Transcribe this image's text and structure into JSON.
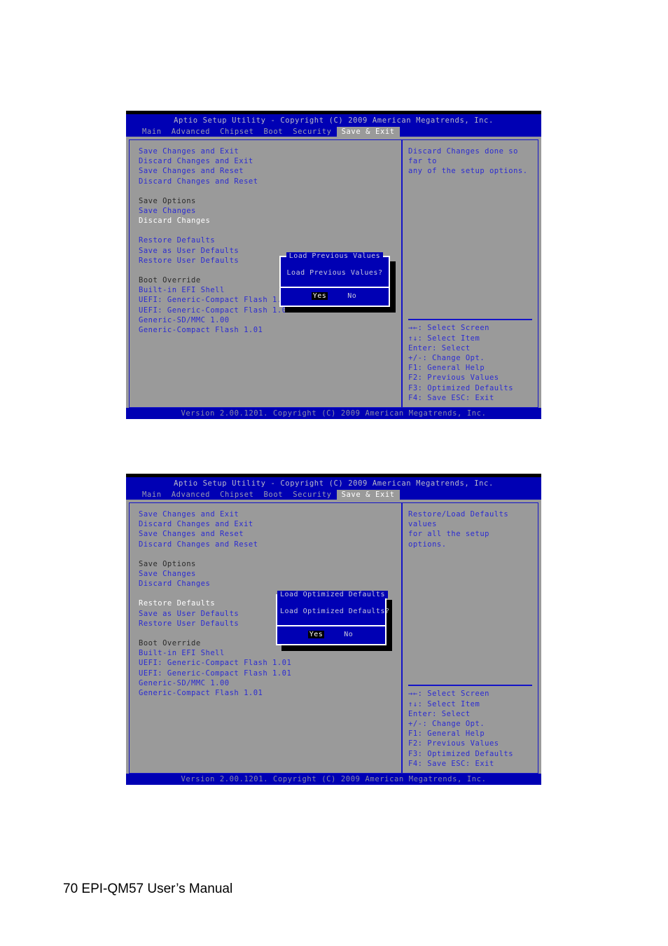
{
  "page": {
    "footer_text": "70 EPI-QM57 User’s Manual"
  },
  "colors": {
    "bios_blue": "#0000b4",
    "bios_gray": "#9a9a9a",
    "item_blue": "#2b2bd2",
    "selected_white": "#ffffff",
    "header_dark": "#2a2a2a",
    "focus_black": "#000000"
  },
  "common": {
    "title": "Aptio Setup Utility - Copyright (C) 2009 American Megatrends, Inc.",
    "version": "Version 2.00.1201. Copyright (C) 2009 American Megatrends, Inc.",
    "tabs": [
      {
        "label": "Main",
        "active": false
      },
      {
        "label": "Advanced",
        "active": false
      },
      {
        "label": "Chipset",
        "active": false
      },
      {
        "label": "Boot",
        "active": false
      },
      {
        "label": "Security",
        "active": false
      },
      {
        "label": "Save & Exit",
        "active": true
      }
    ],
    "keys": [
      "→←: Select Screen",
      "↑↓: Select Item",
      "Enter: Select",
      "+/-: Change Opt.",
      "F1: General Help",
      "F2: Previous Values",
      "F3: Optimized Defaults",
      "F4: Save  ESC: Exit"
    ],
    "menu_items": [
      {
        "label": "Save Changes and Exit",
        "style": "item"
      },
      {
        "label": "Discard Changes and Exit",
        "style": "item"
      },
      {
        "label": "Save Changes and Reset",
        "style": "item"
      },
      {
        "label": "Discard Changes and Reset",
        "style": "item"
      },
      {
        "label": "",
        "style": "spacer"
      },
      {
        "label": "Save Options",
        "style": "header"
      },
      {
        "label": "Save Changes",
        "style": "item"
      },
      {
        "label": "Discard Changes",
        "style": "item"
      },
      {
        "label": "",
        "style": "spacer"
      },
      {
        "label": "Restore Defaults",
        "style": "item"
      },
      {
        "label": "Save as User Defaults",
        "style": "item"
      },
      {
        "label": "Restore User Defaults",
        "style": "item"
      },
      {
        "label": "",
        "style": "spacer"
      },
      {
        "label": "Boot Override",
        "style": "header"
      },
      {
        "label": "Built-in EFI Shell",
        "style": "item"
      },
      {
        "label": "UEFI: Generic-Compact Flash 1.01",
        "style": "item"
      },
      {
        "label": "UEFI: Generic-Compact Flash 1.01",
        "style": "item"
      },
      {
        "label": "Generic-SD/MMC 1.00",
        "style": "item"
      },
      {
        "label": "Generic-Compact Flash 1.01",
        "style": "item"
      }
    ]
  },
  "screen1": {
    "selected_item_index": 7,
    "help": [
      "Discard Changes done so far to",
      "any of the setup options."
    ],
    "dialog": {
      "title": "Load Previous Values",
      "message": "Load Previous Values?",
      "yes_label": "Yes",
      "no_label": "No",
      "focused_button": "Yes"
    }
  },
  "screen2": {
    "selected_item_index": 9,
    "help": [
      "Restore/Load Defaults values",
      "for all the setup options."
    ],
    "dialog": {
      "title": "Load Optimized Defaults",
      "message": "Load Optimized Defaults?",
      "yes_label": "Yes",
      "no_label": "No",
      "focused_button": "Yes"
    }
  }
}
